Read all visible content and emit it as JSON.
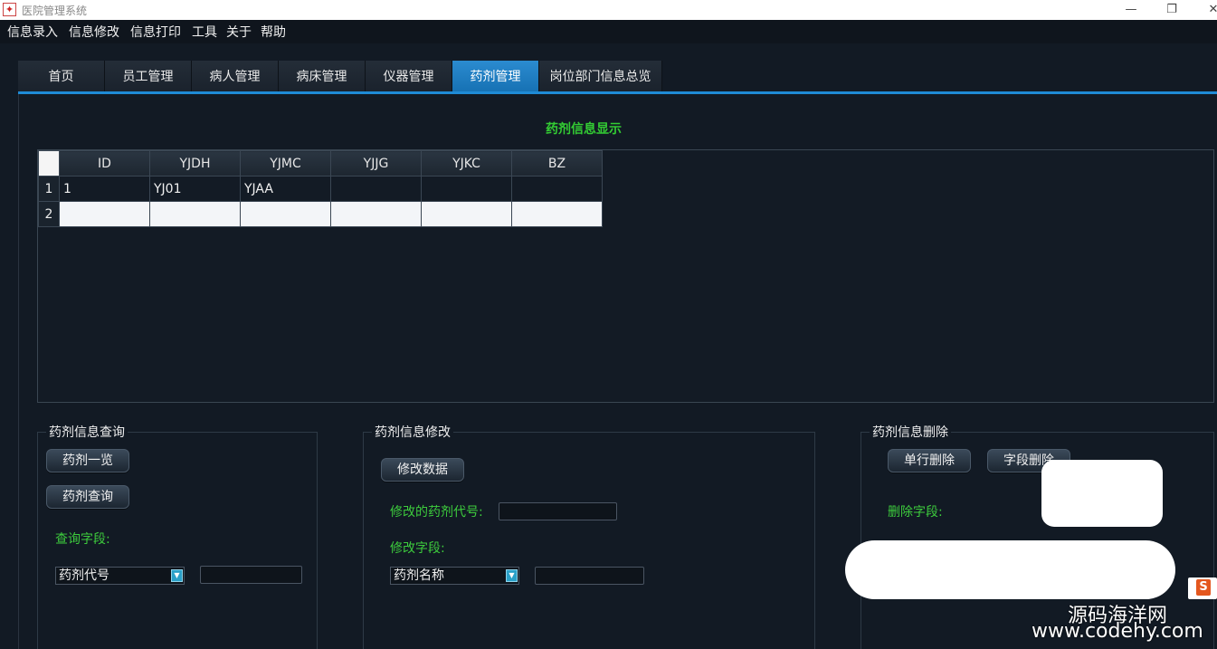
{
  "window": {
    "title": "医院管理系统",
    "minimize_glyph": "—",
    "maximize_glyph": "❐",
    "close_glyph": "✕"
  },
  "menu": [
    "信息录入",
    "信息修改",
    "信息打印",
    "工具",
    "关于",
    "帮助"
  ],
  "tabs": [
    "首页",
    "员工管理",
    "病人管理",
    "病床管理",
    "仪器管理",
    "药剂管理",
    "岗位部门信息总览"
  ],
  "active_tab": "药剂管理",
  "page_title": "药剂信息显示",
  "table": {
    "columns": [
      "ID",
      "YJDH",
      "YJMC",
      "YJJG",
      "YJKC",
      "BZ"
    ],
    "rows": [
      {
        "num": "1",
        "cells": [
          "1",
          "YJ01",
          "YJAA",
          "",
          "",
          ""
        ]
      },
      {
        "num": "2",
        "cells": [
          "",
          "",
          "",
          "",
          "",
          ""
        ]
      }
    ]
  },
  "query_group": {
    "title": "药剂信息查询",
    "list_all_button": "药剂一览",
    "query_button": "药剂查询",
    "field_label": "查询字段:",
    "field_combo_value": "药剂代号",
    "input_value": ""
  },
  "modify_group": {
    "title": "药剂信息修改",
    "modify_button": "修改数据",
    "code_label": "修改的药剂代号:",
    "code_input_value": "",
    "field_label": "修改字段:",
    "field_combo_value": "药剂名称",
    "value_input": ""
  },
  "delete_group": {
    "title": "药剂信息删除",
    "row_delete_button": "单行删除",
    "field_delete_button": "字段删除",
    "field_label": "删除字段:"
  },
  "watermark": {
    "line1": "源码海洋网",
    "line2": "www.codehy.com",
    "logo_letter": "S"
  }
}
